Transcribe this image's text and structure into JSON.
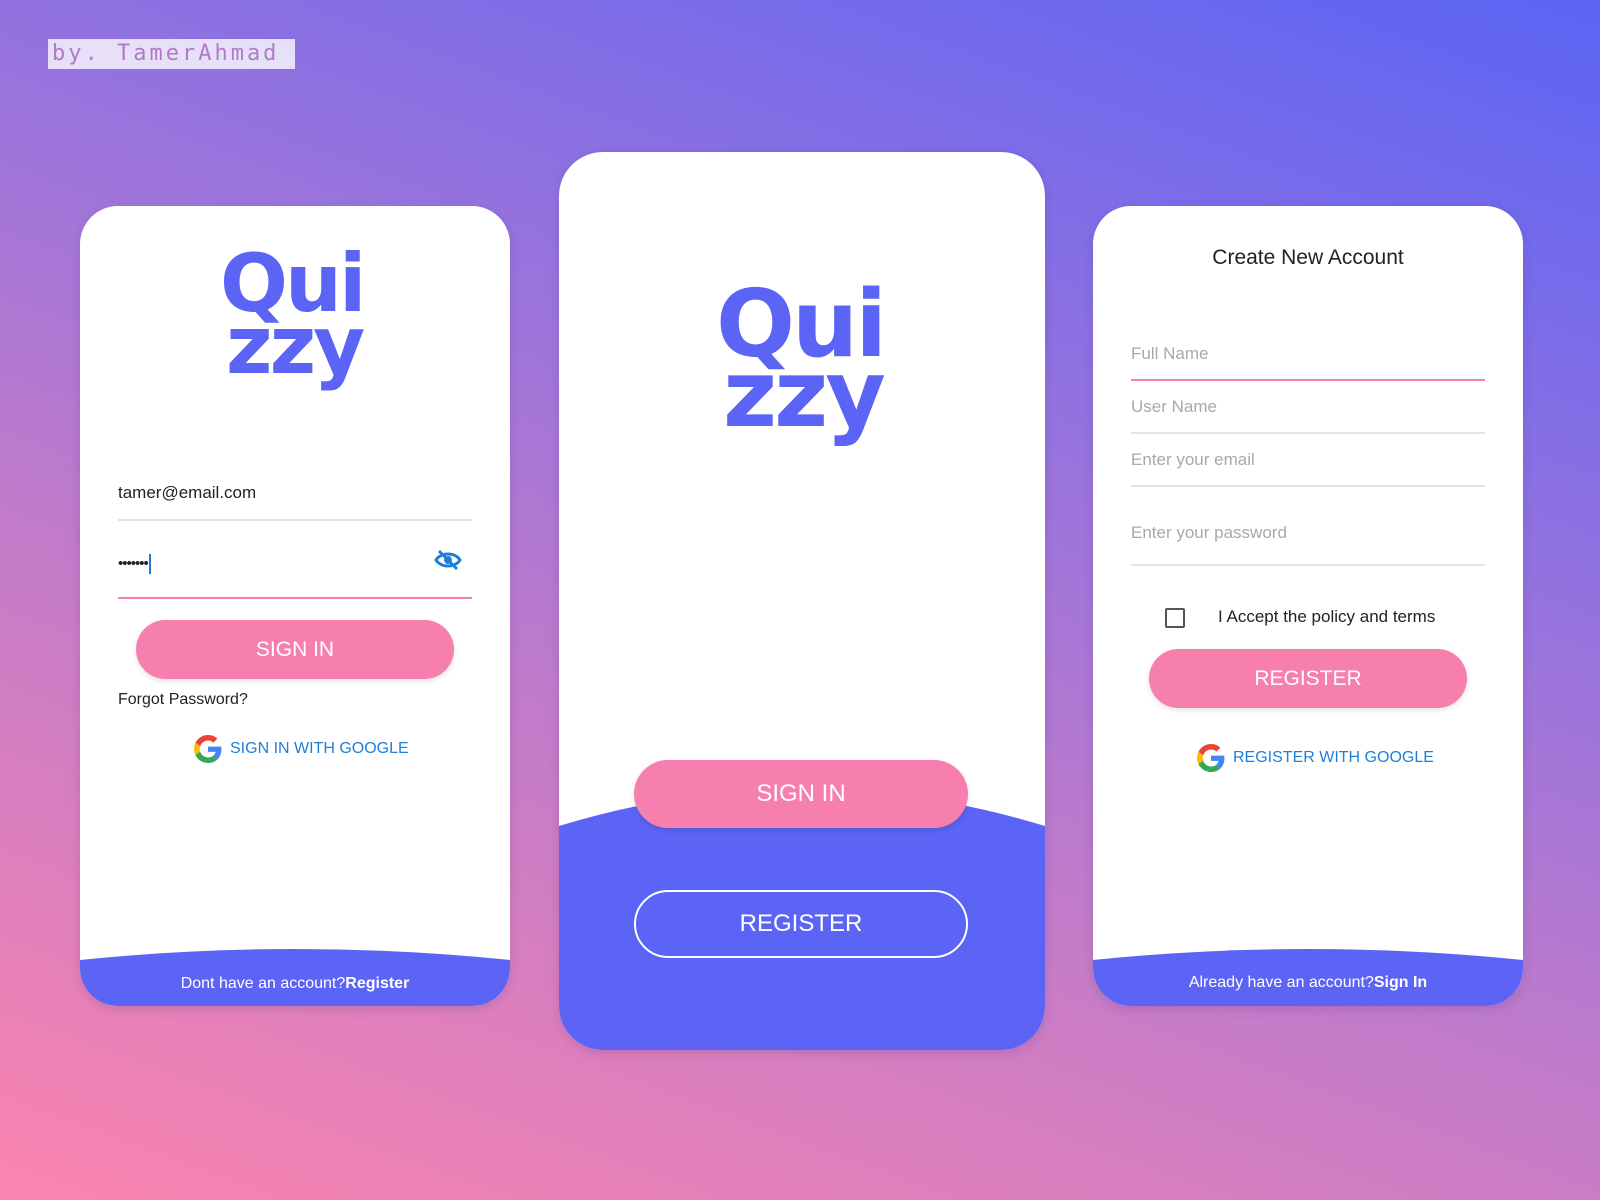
{
  "credit": "by. TamerAhmad",
  "colors": {
    "accent": "#5b64f4",
    "primary_button": "#f77fae",
    "link": "#1f7fd8"
  },
  "logo": {
    "line1": "Qui",
    "line2": "zzy"
  },
  "signin_screen": {
    "email_value": "tamer@email.com",
    "password_value": "•••••••",
    "password_toggle_icon": "eye-off-icon",
    "signin_label": "SIGN IN",
    "forgot_label": "Forgot Password?",
    "google_label": "SIGN IN WITH GOOGLE",
    "footer_prompt": "Dont have an account?",
    "footer_link": "Register"
  },
  "welcome_screen": {
    "signin_label": "SIGN IN",
    "register_label": "REGISTER"
  },
  "register_screen": {
    "title": "Create New Account",
    "fullname_placeholder": "Full Name",
    "username_placeholder": "User Name",
    "email_placeholder": "Enter your email",
    "password_placeholder": "Enter your password",
    "terms_label": "I Accept the policy and terms",
    "terms_checked": false,
    "register_label": "REGISTER",
    "google_label": "REGISTER WITH GOOGLE",
    "footer_prompt": "Already have an account?",
    "footer_link": "Sign In"
  }
}
